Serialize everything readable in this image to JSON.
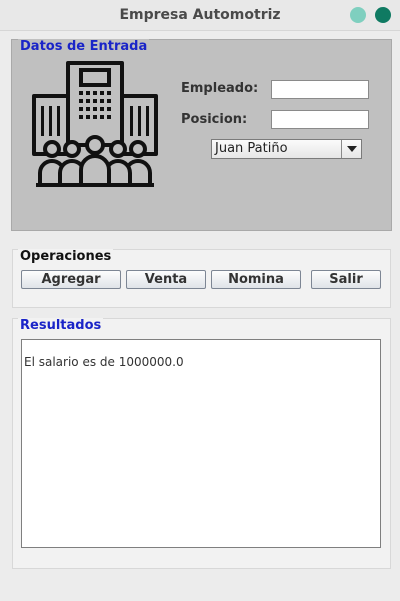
{
  "window": {
    "title": "Empresa Automotriz"
  },
  "entrada": {
    "legend": "Datos de Entrada",
    "empleado_label": "Empleado:",
    "empleado_value": "",
    "posicion_label": "Posicion:",
    "posicion_value": "",
    "combo_selected": "Juan Patiño"
  },
  "operaciones": {
    "legend": "Operaciones",
    "buttons": [
      "Agregar",
      "Venta",
      "Nomina",
      "Salir"
    ]
  },
  "resultados": {
    "legend": "Resultados",
    "text": "El salario es de 1000000.0"
  },
  "colors": {
    "legend_blue": "#1a24c8",
    "panel_gray": "#c0c0c0",
    "close_green": "#0f7a62",
    "min_green": "#7fcfbf"
  }
}
